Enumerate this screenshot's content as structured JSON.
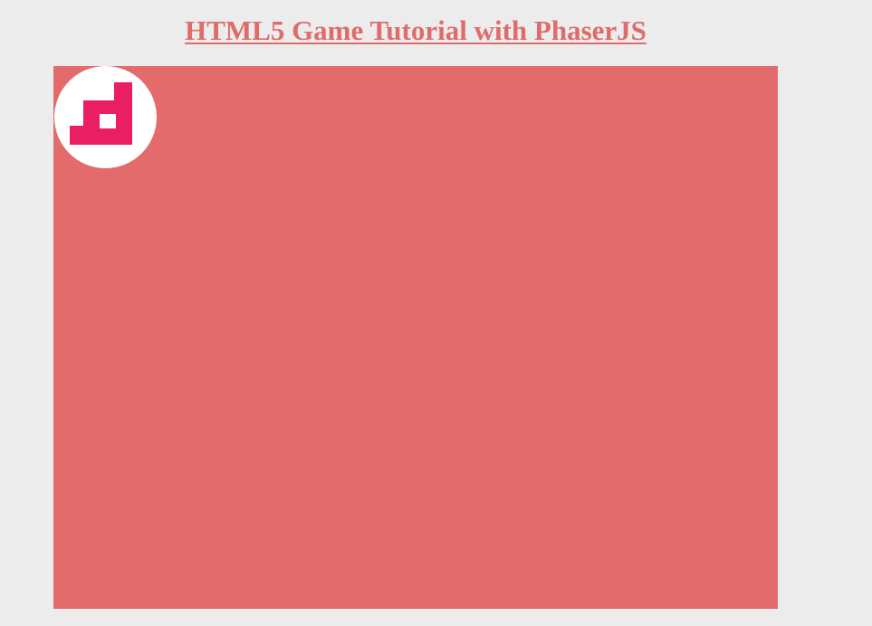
{
  "header": {
    "title": "HTML5 Game Tutorial with PhaserJS"
  },
  "game": {
    "background_color": "#e36b6b",
    "logo": {
      "icon": "phaser-logo-icon",
      "circle_color": "#ffffff",
      "mark_color": "#e91e63"
    }
  }
}
